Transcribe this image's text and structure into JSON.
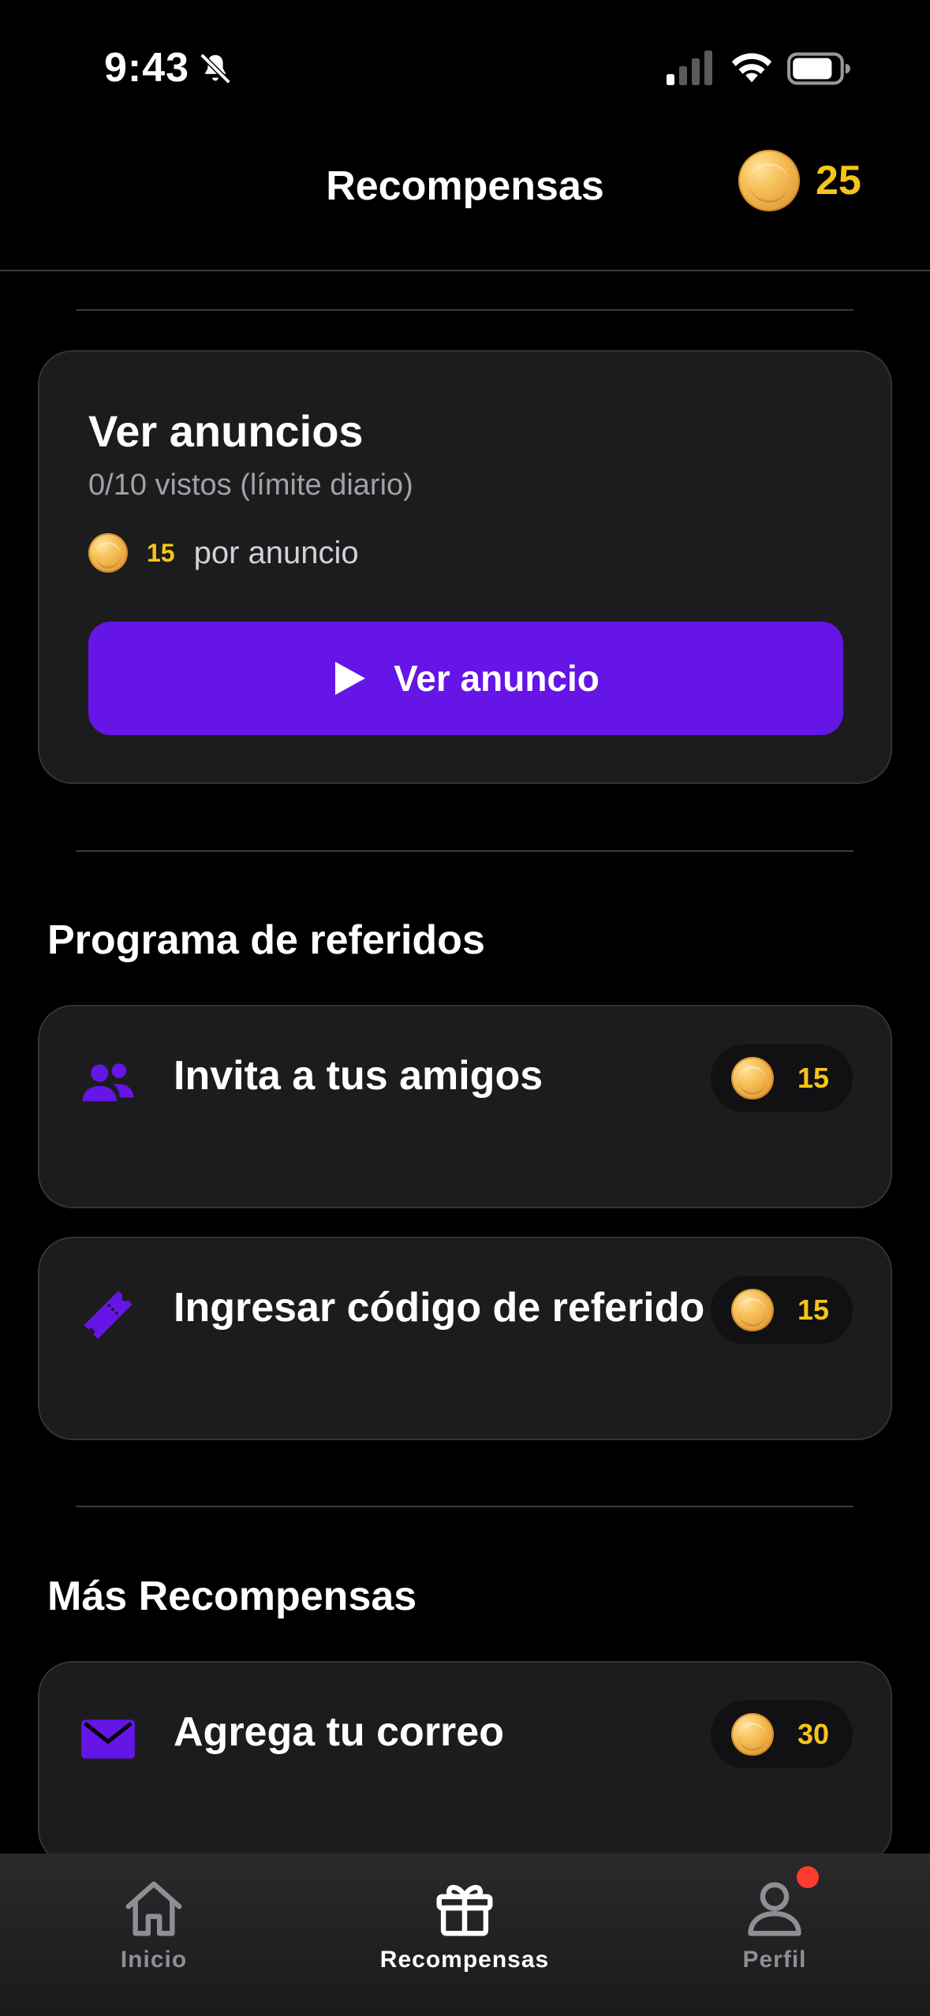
{
  "status_bar": {
    "time": "9:43"
  },
  "header": {
    "title": "Recompensas",
    "coin_balance": "25"
  },
  "ads": {
    "title": "Ver anuncios",
    "subtitle": "0/10 vistos (límite diario)",
    "reward_amount": "15",
    "reward_suffix": "por anuncio",
    "button_label": "Ver anuncio"
  },
  "referrals": {
    "section_title": "Programa de referidos",
    "items": [
      {
        "label": "Invita a tus amigos",
        "reward": "15",
        "icon": "users-icon"
      },
      {
        "label": "Ingresar código de referido",
        "reward": "15",
        "icon": "ticket-icon"
      }
    ]
  },
  "more": {
    "section_title": "Más Recompensas",
    "items": [
      {
        "label": "Agrega tu correo",
        "reward": "30",
        "icon": "mail-icon"
      }
    ]
  },
  "tab_bar": {
    "tabs": [
      {
        "label": "Inicio",
        "icon": "home-icon",
        "active": false
      },
      {
        "label": "Recompensas",
        "icon": "gift-icon",
        "active": true
      },
      {
        "label": "Perfil",
        "icon": "user-icon",
        "active": false,
        "badge": true
      }
    ]
  },
  "colors": {
    "accent": "#6515e5",
    "coin_text": "#f5c518",
    "card_bg": "#1c1c1e",
    "badge": "#ff3b30"
  }
}
